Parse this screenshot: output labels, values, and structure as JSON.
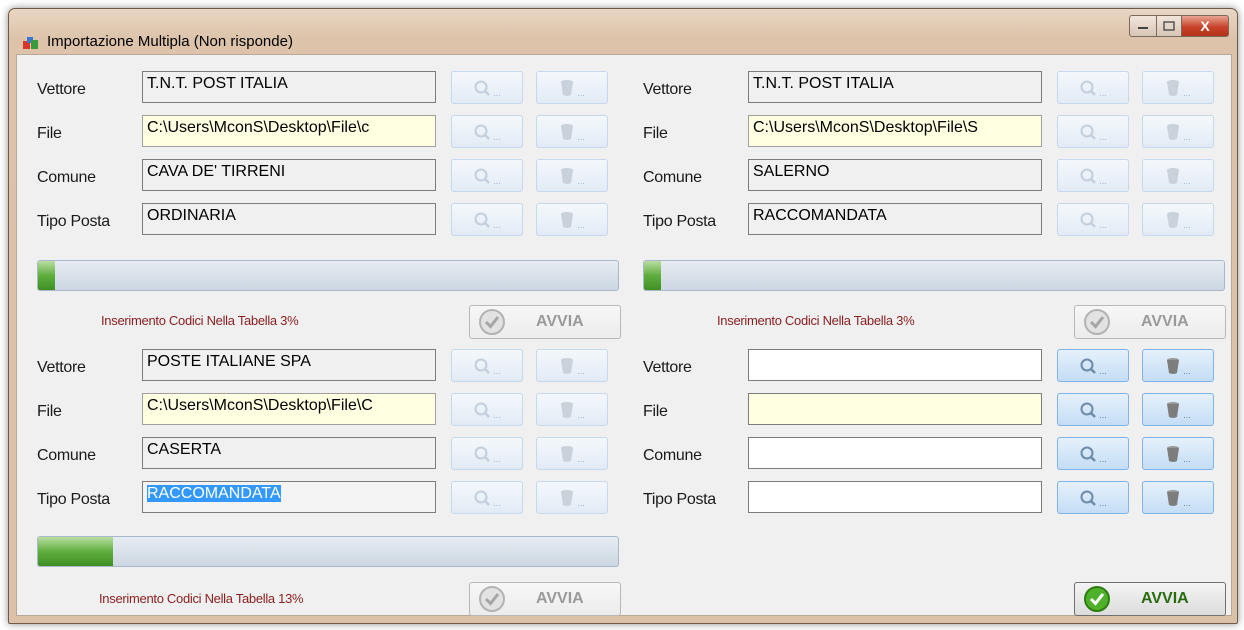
{
  "window": {
    "title": "Importazione Multipla  (Non risponde)",
    "close_label": "X"
  },
  "labels": {
    "vettore": "Vettore",
    "file": "File",
    "comune": "Comune",
    "tipo_posta": "Tipo Posta",
    "button_dots": "...",
    "avvia": "AVVIA"
  },
  "panels": [
    {
      "vettore": "T.N.T. POST ITALIA",
      "file": "C:\\Users\\MconS\\Desktop\\File\\c",
      "comune": "CAVA DE' TIRRENI",
      "tipo_posta": "ORDINARIA",
      "status": "Inserimento Codici Nella Tabella 3%",
      "progress_percent": 3,
      "buttons_enabled": false
    },
    {
      "vettore": "T.N.T. POST ITALIA",
      "file": "C:\\Users\\MconS\\Desktop\\File\\S",
      "comune": "SALERNO",
      "tipo_posta": "RACCOMANDATA",
      "status": "Inserimento Codici Nella Tabella 3%",
      "progress_percent": 3,
      "buttons_enabled": false
    },
    {
      "vettore": "POSTE ITALIANE SPA",
      "file": "C:\\Users\\MconS\\Desktop\\File\\C",
      "comune": "CASERTA",
      "tipo_posta": "RACCOMANDATA",
      "status": "Inserimento Codici Nella Tabella 13%",
      "progress_percent": 13,
      "buttons_enabled": false
    },
    {
      "vettore": "",
      "file": "",
      "comune": "",
      "tipo_posta": "",
      "buttons_enabled": true
    }
  ],
  "icons": {
    "app": "app-blocks-icon",
    "search": "magnifier-icon",
    "trash": "trash-bin-icon",
    "check": "check-circle-icon"
  },
  "colors": {
    "status_text": "#8b1e1e",
    "progress_green": "#5fae3e",
    "avvia_active_text": "#2a6b12",
    "file_field_bg": "#ffffe1",
    "selection": "#3399ff"
  }
}
